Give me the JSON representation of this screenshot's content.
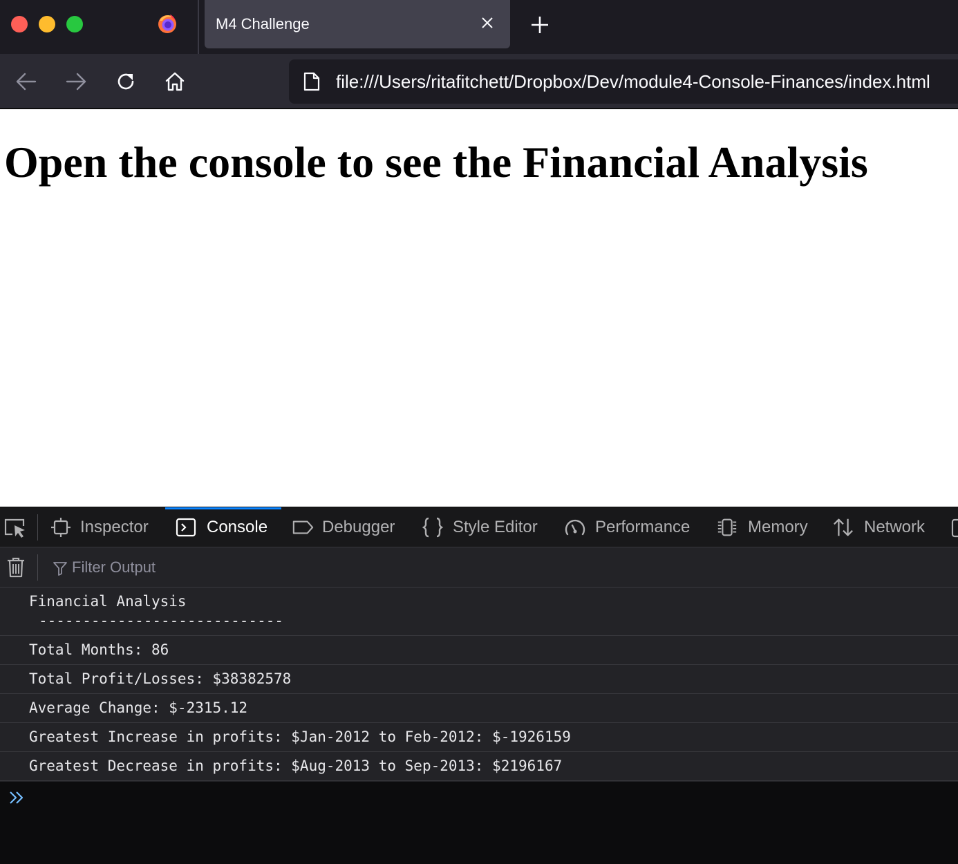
{
  "browser": {
    "tab": {
      "title": "M4 Challenge"
    },
    "url": "file:///Users/ritafitchett/Dropbox/Dev/module4-Console-Finances/index.html",
    "icons": {
      "back": "arrow-left-icon",
      "forward": "arrow-right-icon",
      "reload": "reload-icon",
      "home": "home-icon",
      "page": "document-icon",
      "new_tab": "plus-icon",
      "close_tab": "close-icon"
    }
  },
  "page": {
    "heading": "Open the console to see the Financial Analysis"
  },
  "devtools": {
    "tabs": [
      {
        "label": "Inspector",
        "icon": "inspector-icon"
      },
      {
        "label": "Console",
        "icon": "console-icon",
        "selected": true
      },
      {
        "label": "Debugger",
        "icon": "debugger-icon"
      },
      {
        "label": "Style Editor",
        "icon": "braces-icon"
      },
      {
        "label": "Performance",
        "icon": "gauge-icon"
      },
      {
        "label": "Memory",
        "icon": "memory-chip-icon"
      },
      {
        "label": "Network",
        "icon": "network-arrows-icon"
      }
    ],
    "filter": {
      "placeholder": "Filter Output",
      "value": ""
    },
    "console_lines": {
      "header": "Financial Analysis",
      "divider": "----------------------------",
      "total_months": "Total Months: 86",
      "total_profit": "Total Profit/Losses: $38382578",
      "average_change": "Average Change: $-2315.12",
      "greatest_increase": "Greatest Increase in profits: $Jan-2012 to Feb-2012: $-1926159",
      "greatest_decrease": "Greatest Decrease in profits: $Aug-2013 to Sep-2013: $2196167"
    },
    "colors": {
      "accent": "#0a84ff",
      "panel": "#232327",
      "toolbar": "#18181a"
    }
  }
}
